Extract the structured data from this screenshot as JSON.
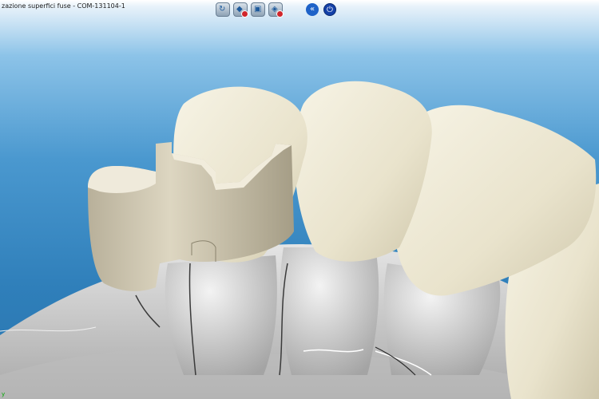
{
  "window": {
    "title": "zazione superfici fuse  - COM-131104-1"
  },
  "toolbar": {
    "buttons": [
      {
        "icon": "view-rotate-icon"
      },
      {
        "icon": "view-delete-icon"
      },
      {
        "icon": "model-box-icon"
      },
      {
        "icon": "layer-remove-icon"
      }
    ],
    "back_label": "«",
    "power_label": "⏻"
  },
  "viewport": {
    "axis_label": "y"
  },
  "colors": {
    "background_top": "#8cc3e8",
    "background_bottom": "#2a75ae",
    "tooth": "#ece7d2",
    "gum_model": "#cfcfcf",
    "accent_blue": "#1e62c8"
  }
}
